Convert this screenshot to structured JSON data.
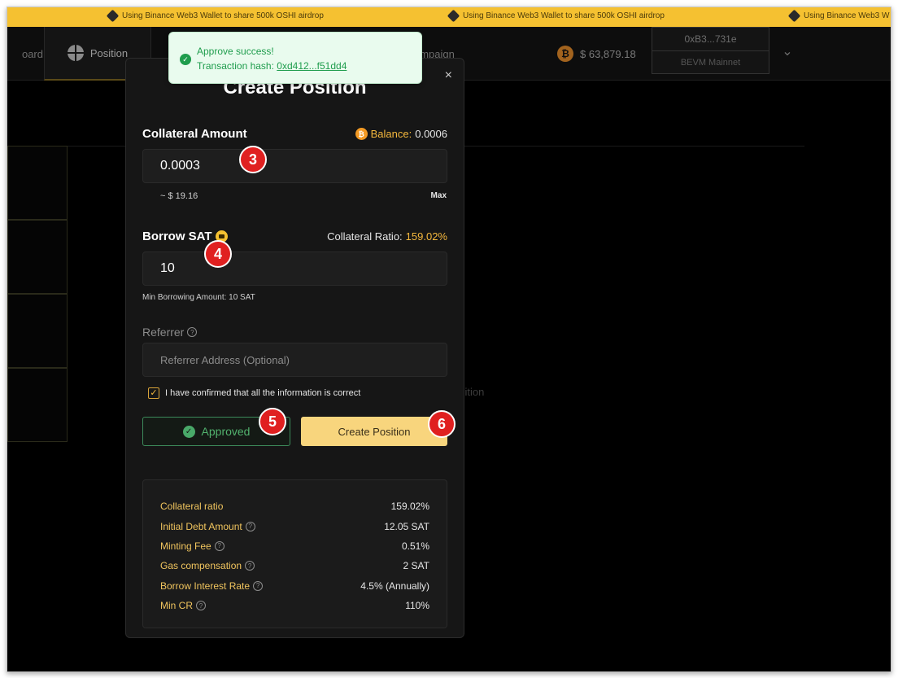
{
  "ticker": {
    "message": "Using Binance Web3 Wallet to share 500k OSHI airdrop",
    "message_cut": "Using Binance Web3 W"
  },
  "nav": {
    "tab_board_fragment": "oard",
    "tab_position": "Position",
    "tab_campaign_fragment": "ampaign",
    "btc_price": "$ 63,879.18",
    "wallet_address": "0xB3...731e",
    "wallet_network": "BEVM Mainnet"
  },
  "background": {
    "position_fragment": "sition"
  },
  "toast": {
    "title": "Approve success!",
    "hash_label": "Transaction hash:",
    "hash_value": "0xd412...f51dd4"
  },
  "modal": {
    "title": "Create Position",
    "close": "×",
    "collateral": {
      "label": "Collateral Amount",
      "balance_label": "Balance:",
      "balance_value": "0.0006",
      "input_value": "0.0003",
      "usd_estimate": "~ $ 19.16",
      "max_label": "Max"
    },
    "borrow": {
      "label": "Borrow SAT",
      "ratio_label": "Collateral Ratio:",
      "ratio_value": "159.02%",
      "input_value": "10",
      "min_note": "Min Borrowing Amount: 10 SAT"
    },
    "referrer": {
      "label": "Referrer",
      "placeholder": "Referrer Address (Optional)"
    },
    "confirm_text": "I have confirmed that all the information is correct",
    "approved_button": "Approved",
    "create_button": "Create Position",
    "summary": [
      {
        "key": "Collateral ratio",
        "value": "159.02%",
        "help": false
      },
      {
        "key": "Initial Debt Amount",
        "value": "12.05 SAT",
        "help": true
      },
      {
        "key": "Minting Fee",
        "value": "0.51%",
        "help": true
      },
      {
        "key": "Gas compensation",
        "value": "2 SAT",
        "help": true
      },
      {
        "key": "Borrow Interest Rate",
        "value": "4.5% (Annually)",
        "help": true
      },
      {
        "key": "Min CR",
        "value": "110%",
        "help": true
      }
    ]
  },
  "markers": [
    "3",
    "4",
    "5",
    "6"
  ],
  "colors": {
    "banner": "#f5c131",
    "accent_gold": "#f5b83d",
    "create_button": "#f8d57d",
    "success_green": "#52b26e",
    "marker_red": "#e02020"
  }
}
